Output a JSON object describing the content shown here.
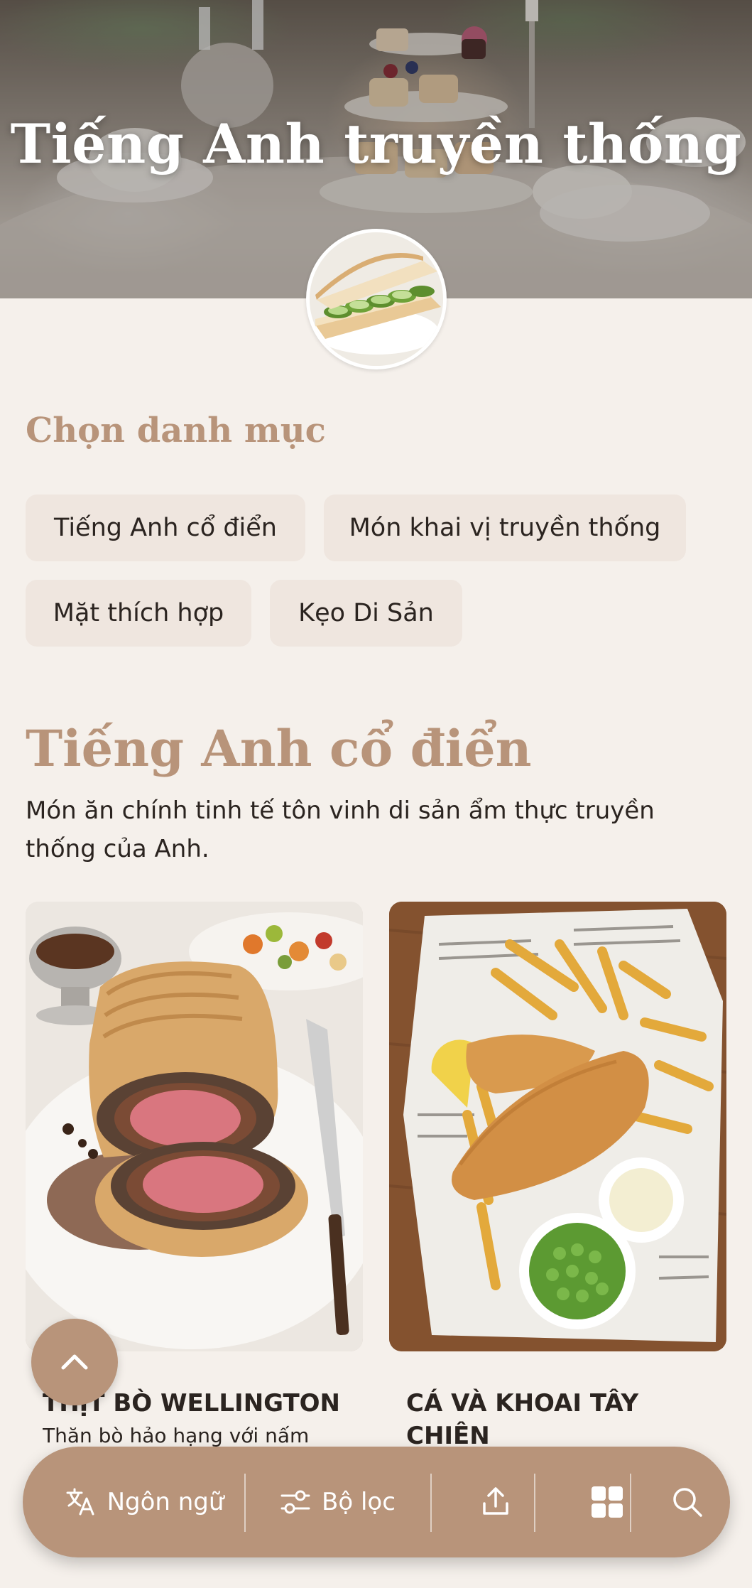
{
  "hero": {
    "title": "Tiếng Anh truyền thống"
  },
  "categories": {
    "heading": "Chọn danh mục",
    "items": [
      {
        "label": "Tiếng Anh cổ điển"
      },
      {
        "label": "Món khai vị truyền thống"
      },
      {
        "label": "Mặt thích hợp"
      },
      {
        "label": "Kẹo Di Sản"
      }
    ]
  },
  "section": {
    "title": "Tiếng Anh cổ điển",
    "description": "Món ăn chính tinh tế tôn vinh di sản ẩm thực truyền thống của Anh."
  },
  "dishes": [
    {
      "name": "THỊT BÒ WELLINGTON",
      "description": "Thăn bò hảo hạng với nấm"
    },
    {
      "name": "CÁ VÀ KHOAI TÂY CHIÊN"
    }
  ],
  "bottom_bar": {
    "language_label": "Ngôn ngữ",
    "filter_label": "Bộ lọc"
  },
  "colors": {
    "accent": "#b8947a",
    "background": "#f5f0eb",
    "chip": "#efe6df",
    "text": "#2b2420"
  },
  "icons": [
    "translate-icon",
    "filter-icon",
    "share-icon",
    "grid-icon",
    "search-icon",
    "chevron-up-icon"
  ]
}
